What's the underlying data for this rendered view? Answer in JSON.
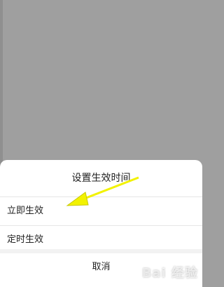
{
  "sheet": {
    "title": "设置生效时间",
    "options": [
      {
        "label": "立即生效"
      },
      {
        "label": "定时生效"
      }
    ],
    "cancel_label": "取消"
  },
  "annotation": {
    "arrow_color": "#f2f200",
    "points_to": "立即生效"
  },
  "watermark": {
    "text": "Bai 经验"
  },
  "colors": {
    "overlay": "#9f9f9f",
    "sheet_bg": "#ffffff",
    "divider": "#e6e6e6",
    "text": "#222222"
  }
}
